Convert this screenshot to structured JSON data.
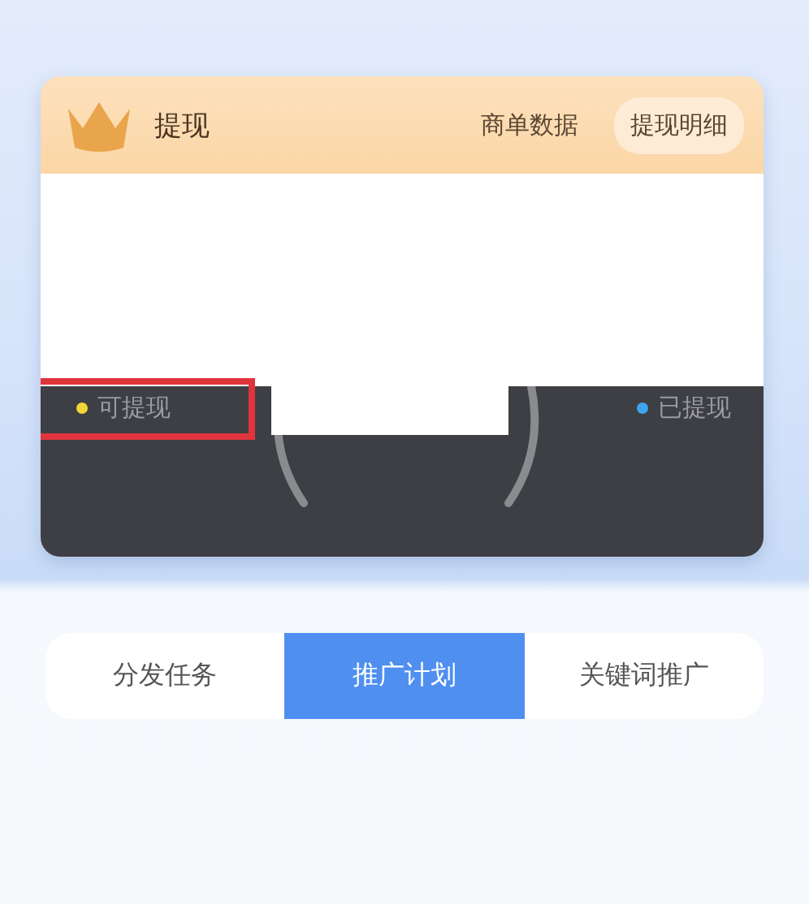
{
  "card": {
    "title": "提现",
    "header_links": [
      {
        "label": "商单数据",
        "selected": false
      },
      {
        "label": "提现明细",
        "selected": true
      }
    ],
    "legend": [
      {
        "label": "可提现",
        "color": "#f2d43a",
        "highlighted": true
      },
      {
        "label": "已提现",
        "color": "#3fa4f0",
        "highlighted": false
      }
    ]
  },
  "tabs": [
    {
      "label": "分发任务",
      "selected": false
    },
    {
      "label": "推广计划",
      "selected": true
    },
    {
      "label": "关键词推广",
      "selected": false
    }
  ]
}
